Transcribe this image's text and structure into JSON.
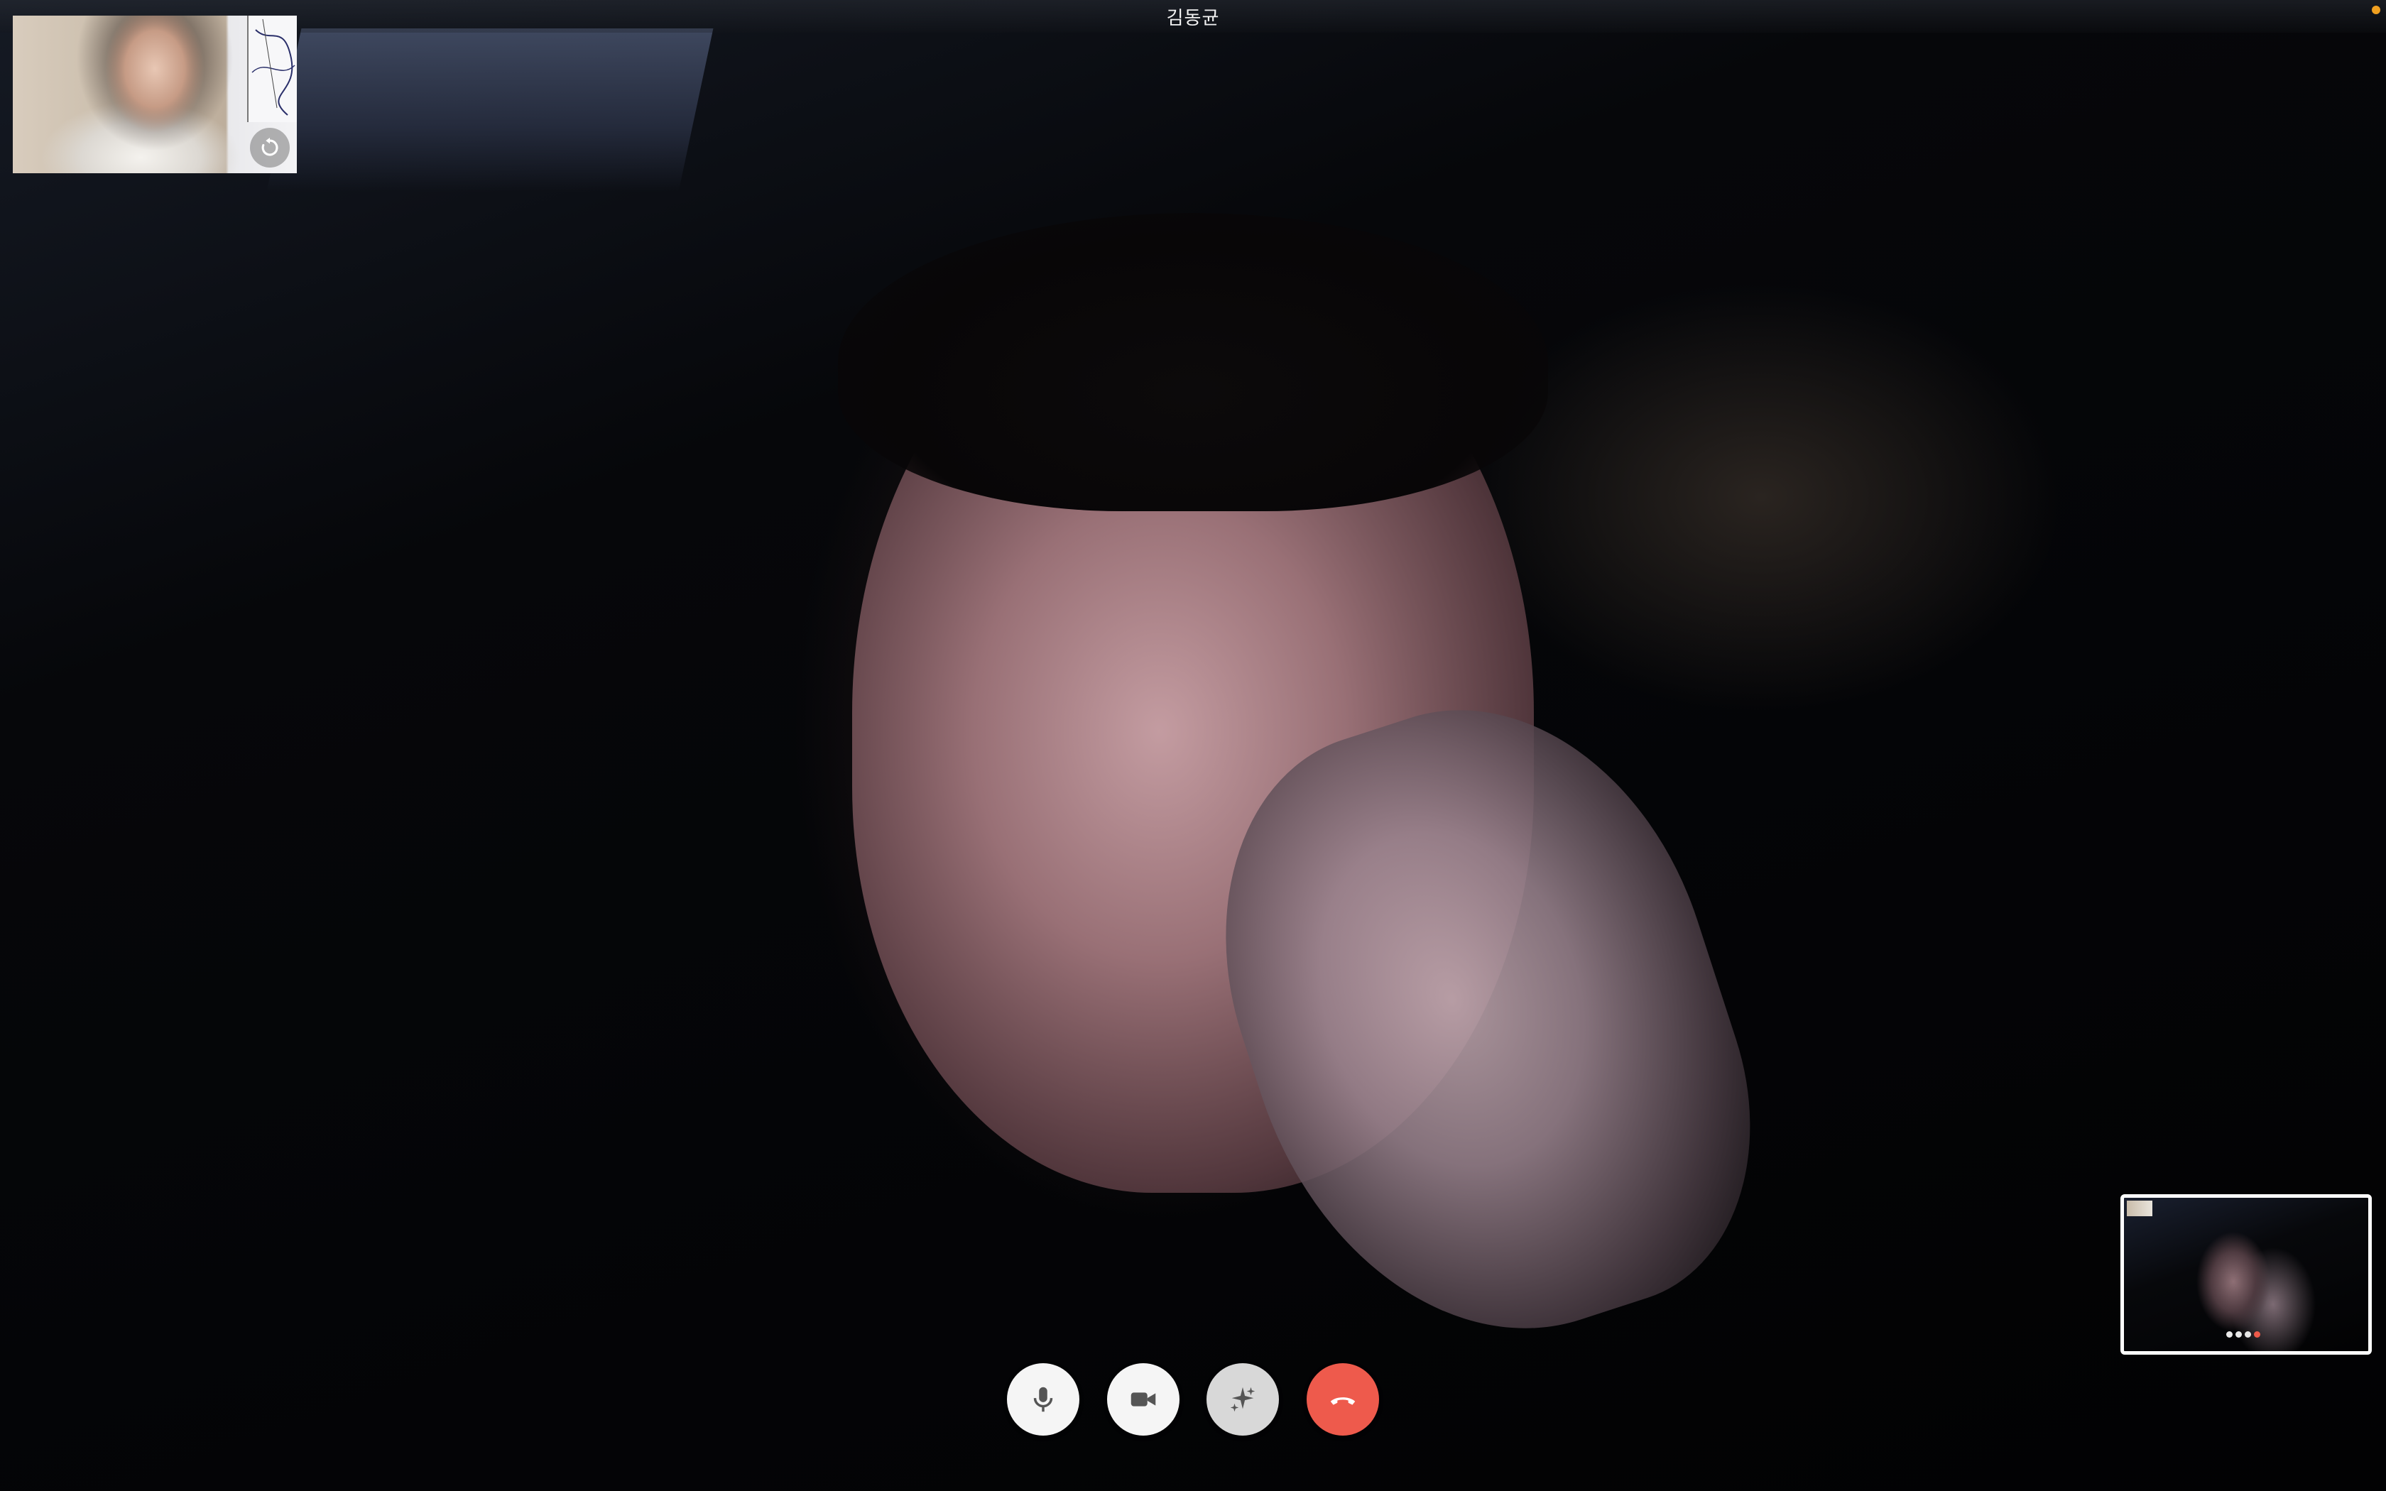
{
  "window": {
    "title": "김동균",
    "indicator_color": "#f0a020"
  },
  "self_view": {
    "rotate_icon": "rotate-camera-icon"
  },
  "controls": {
    "mute_icon": "microphone-icon",
    "video_icon": "video-camera-icon",
    "effects_icon": "sparkles-icon",
    "end_call_icon": "phone-hangup-icon",
    "end_call_color": "#ee5a4c"
  },
  "mini_preview": {
    "control_dots": [
      "light",
      "light",
      "light",
      "red"
    ]
  }
}
